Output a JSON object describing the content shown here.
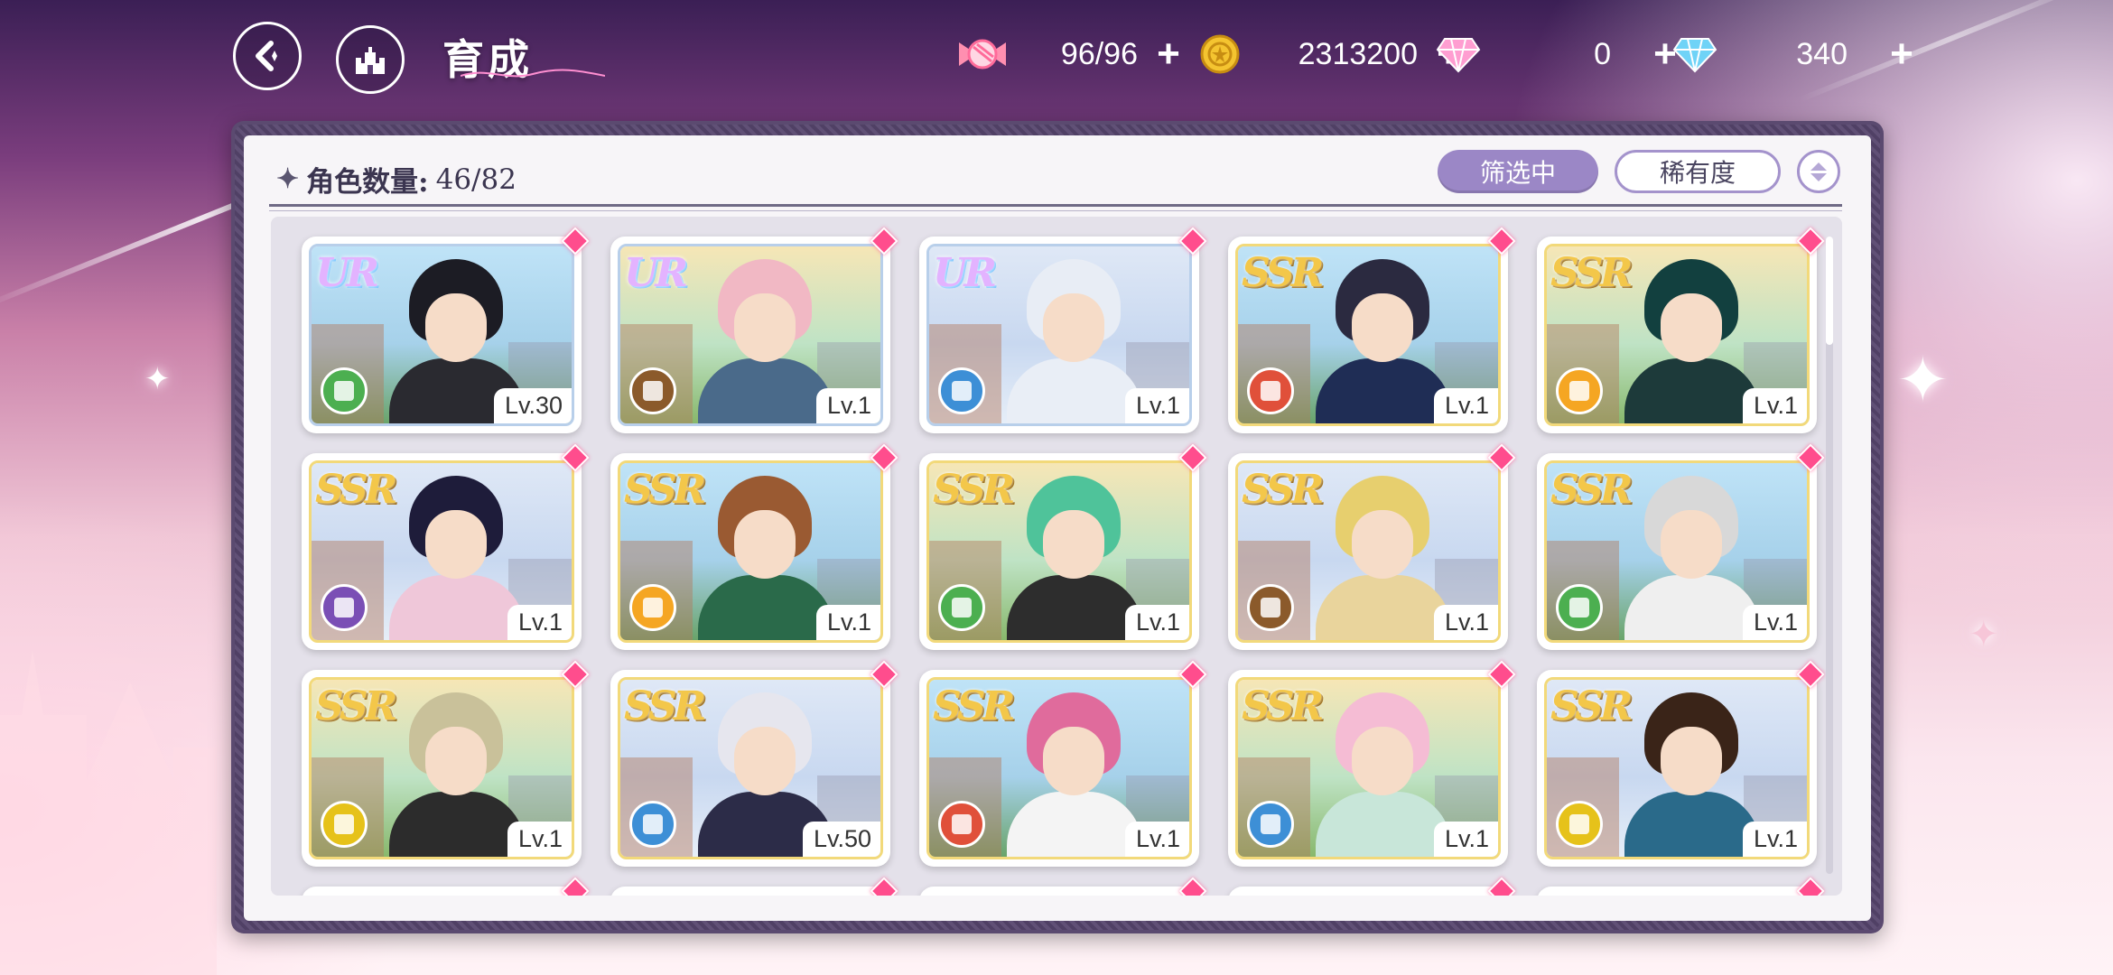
{
  "header": {
    "title": "育成",
    "resources": [
      {
        "name": "stamina",
        "icon": "candy-icon",
        "value": "96/96"
      },
      {
        "name": "coins",
        "icon": "coin-icon",
        "value": "2313200"
      },
      {
        "name": "pink-gems",
        "icon": "pink-diamond-icon",
        "value": "0"
      },
      {
        "name": "blue-gems",
        "icon": "blue-diamond-icon",
        "value": "340"
      }
    ]
  },
  "panel": {
    "count_label": "角色数量:",
    "count_value": "46/82",
    "filter_label": "筛选中",
    "sort_label": "稀有度"
  },
  "attribute_colors": {
    "green": "#4caf50",
    "brown": "#8b5a2b",
    "blue": "#3d8fd6",
    "red": "#e0503a",
    "orange": "#f5a623",
    "purple": "#7a4fb5",
    "yellow": "#e6c21a"
  },
  "cards": [
    {
      "rarity": "UR",
      "level": "Lv.30",
      "attr": "green"
    },
    {
      "rarity": "UR",
      "level": "Lv.1",
      "attr": "brown"
    },
    {
      "rarity": "UR",
      "level": "Lv.1",
      "attr": "blue"
    },
    {
      "rarity": "SSR",
      "level": "Lv.1",
      "attr": "red"
    },
    {
      "rarity": "SSR",
      "level": "Lv.1",
      "attr": "orange"
    },
    {
      "rarity": "SSR",
      "level": "Lv.1",
      "attr": "purple"
    },
    {
      "rarity": "SSR",
      "level": "Lv.1",
      "attr": "orange"
    },
    {
      "rarity": "SSR",
      "level": "Lv.1",
      "attr": "green"
    },
    {
      "rarity": "SSR",
      "level": "Lv.1",
      "attr": "brown"
    },
    {
      "rarity": "SSR",
      "level": "Lv.1",
      "attr": "green"
    },
    {
      "rarity": "SSR",
      "level": "Lv.1",
      "attr": "yellow"
    },
    {
      "rarity": "SSR",
      "level": "Lv.50",
      "attr": "blue"
    },
    {
      "rarity": "SSR",
      "level": "Lv.1",
      "attr": "red"
    },
    {
      "rarity": "SSR",
      "level": "Lv.1",
      "attr": "blue"
    },
    {
      "rarity": "SSR",
      "level": "Lv.1",
      "attr": "yellow"
    }
  ]
}
